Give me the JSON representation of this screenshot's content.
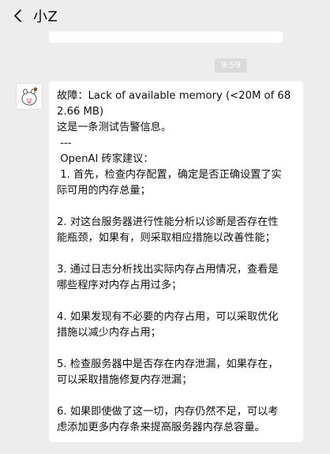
{
  "header": {
    "title": "小Z",
    "back_icon": "chevron-left-icon"
  },
  "chat": {
    "timestamp": "9:59",
    "message": {
      "lines": [
        "故障：Lack of available memory (<20M of 68",
        "2.66 MB)",
        "这是一条测试告警信息。",
        " ---",
        " OpenAI 砖家建议：",
        " 1. 首先，检查内存配置，确定是否正确设置了实",
        "际可用的内存总量；",
        "",
        "2. 对这台服务器进行性能分析以诊断是否存在性",
        "能瓶颈，如果有，则采取相应措施以改善性能；",
        "",
        "3. 通过日志分析找出实际内存占用情况，查看是",
        "哪些程序对内存占用过多；",
        "",
        "4. 如果发现有不必要的内存占用，可以采取优化",
        "措施以减少内存占用；",
        "",
        "5. 检查服务器中是否存在内存泄漏，如果存在，",
        "可以采取措施修复内存泄漏；",
        "",
        "6. 如果即使做了这一切，内存仍然不足，可以考",
        "虑添加更多内存条来提高服务器内存总容量。"
      ]
    }
  }
}
